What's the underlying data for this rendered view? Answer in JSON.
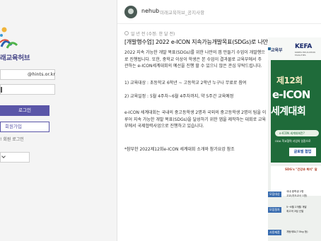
{
  "sidebar": {
    "logo_text": "래교육허브",
    "email_value": "@hints.or.kr",
    "login_label": "로그인",
    "signup_label": "회원가입",
    "member_login_label": "! 회원 로그인"
  },
  "post": {
    "author": "nehub",
    "breadcrumb": "미래교육허브_공지사항",
    "meta": "일 년 전 (수정: 한 달 전)",
    "title": "[개발행수업] 2022 e-ICON 지속가능개발목표(SDGs)로 나만의 앱만들기 수업 안내",
    "paragraphs": {
      "p1_line1": "2022 지속 가능한 개발 목표(SDGs)를 위한 나만의 앱 만들기 수업이 개발행으",
      "p1_line2": "로 진행됩니다. 또한, 중학교 이상이 학생은 본 수업이 결과물로 교육부에서 주",
      "p1_line3": "관하는 e-ICON세계대회의 예선을 진행 할 수 있으니 많은 관심 부탁드립니다.",
      "p2_line1": "1) 교육대상 : 초등학교 6학년 ~ 고등학교 2학년 누구나 무료로 참여",
      "p2_line2": "2) 교육일정 : 5월 4주차~6월 4주차까지, 약 5주간 교육예정",
      "p3_line1": "e-ICON 세계대회는 국내의 중고등학생 2명과 국외의 중고등학생 2명이 팀을 이",
      "p3_line2": "루어 지속 가능한 개발 목표(SDGs)을 달성하기 위한 앱을 제작하는 대회로 교육",
      "p3_line3": "부에서 국제협력사업으로 진행하고 있습니다.",
      "p4_line1": "*참부한 2022제12회e-ICON 세계대회 소개와 참가요강 참조"
    }
  },
  "poster": {
    "moe": "교육부",
    "kefa": "KEFA",
    "kefa_sub": "KOREA EDUCATION FACILITIES",
    "no12": "제12회",
    "eicon": "e-ICON",
    "world": "세계대회",
    "pill": "e-ICON 세계대회란?",
    "odathin": "ODA 학교협력 사업의 일환으로",
    "bluebox": "글로벌 협업",
    "quote": "SDG's \"건강과 복지\" 달",
    "label1": "모집대상",
    "label2": "모집절차",
    "label3": "사용제품",
    "text1a": "국내 중학생 2명",
    "text1b": "고교(지도교사 1명)",
    "text2a": "5~6월 2개월 개발",
    "text2b": "최고의 3팀 선발",
    "text3": "개동세트(7.5kg 등)"
  },
  "colors": {
    "accent": "#5a56a8",
    "poster_green": "#1f6b3a",
    "poster_blue": "#3a6db0"
  }
}
